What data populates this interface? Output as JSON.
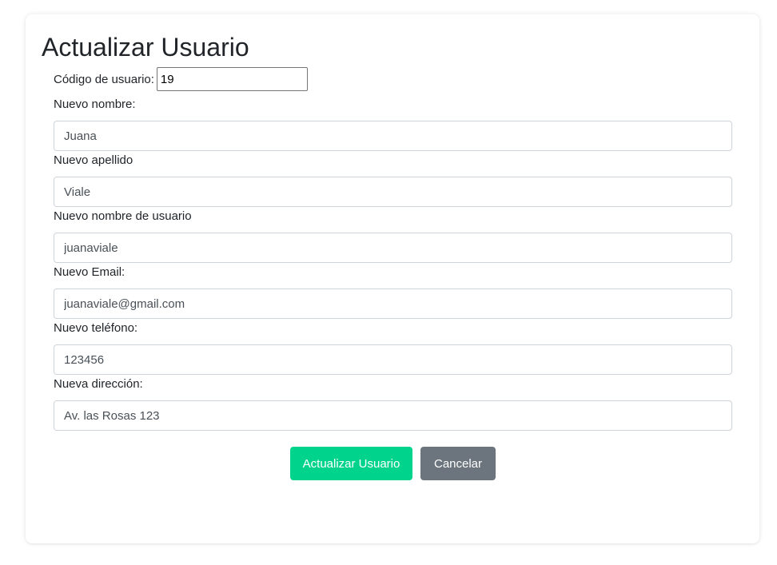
{
  "page": {
    "title": "Actualizar Usuario"
  },
  "form": {
    "user_code": {
      "label": "Código de usuario:",
      "value": "19"
    },
    "fields": [
      {
        "label": "Nuevo nombre:",
        "value": "Juana"
      },
      {
        "label": "Nuevo apellido",
        "value": "Viale"
      },
      {
        "label": "Nuevo nombre de usuario",
        "value": "juanaviale"
      },
      {
        "label": "Nuevo Email:",
        "value": "juanaviale@gmail.com"
      },
      {
        "label": "Nuevo teléfono:",
        "value": "123456"
      },
      {
        "label": "Nueva dirección:",
        "value": "Av. las Rosas 123"
      }
    ]
  },
  "actions": {
    "submit_label": "Actualizar Usuario",
    "cancel_label": "Cancelar"
  },
  "colors": {
    "submit_button": "#00d38b",
    "cancel_button": "#6c757d",
    "text": "#212529",
    "input_border": "#ced4da"
  }
}
